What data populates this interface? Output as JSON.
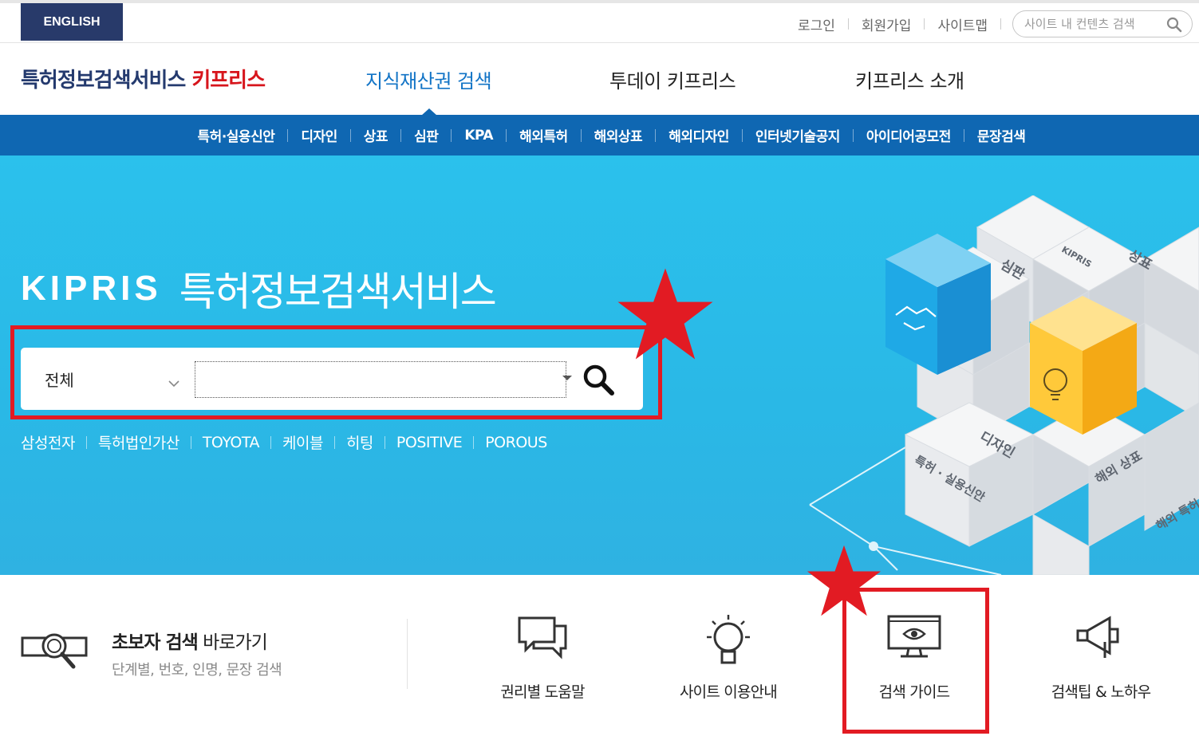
{
  "topbar": {
    "english_label": "ENGLISH",
    "login": "로그인",
    "signup": "회원가입",
    "sitemap": "사이트맵",
    "site_search_placeholder": "사이트 내 컨텐츠 검색"
  },
  "header": {
    "logo_part1": "특허정보검색서비스",
    "logo_part2": "키프리스",
    "nav": [
      "지식재산권 검색",
      "투데이 키프리스",
      "키프리스 소개"
    ],
    "active_nav": "지식재산권 검색"
  },
  "subnav": [
    "특허·실용신안",
    "디자인",
    "상표",
    "심판",
    "KPA",
    "해외특허",
    "해외상표",
    "해외디자인",
    "인터넷기술공지",
    "아이디어공모전",
    "문장검색"
  ],
  "hero": {
    "brand": "KIPRIS",
    "title": "특허정보검색서비스",
    "scope_value": "전체",
    "query_value": "",
    "hot_keywords": [
      "삼성전자",
      "특허법인가산",
      "TOYOTA",
      "케이블",
      "히팅",
      "POSITIVE",
      "POROUS"
    ],
    "cube_labels": [
      "심판",
      "KIPRIS",
      "상표",
      "디자인",
      "특허 · 실용신안",
      "해외 상표",
      "해외 특허"
    ]
  },
  "quick": {
    "beginner_title_bold": "초보자 검색",
    "beginner_title_rest": " 바로가기",
    "beginner_sub": "단계별, 번호, 인명, 문장 검색",
    "items": [
      "권리별 도움말",
      "사이트 이용안내",
      "검색 가이드",
      "검색팁 & 노하우"
    ]
  },
  "colors": {
    "brand_navy": "#243a6e",
    "brand_red": "#d7151c",
    "subnav_blue": "#0f67b2",
    "hero_cyan": "#2bc1ec",
    "annotation_red": "#e21b23"
  }
}
